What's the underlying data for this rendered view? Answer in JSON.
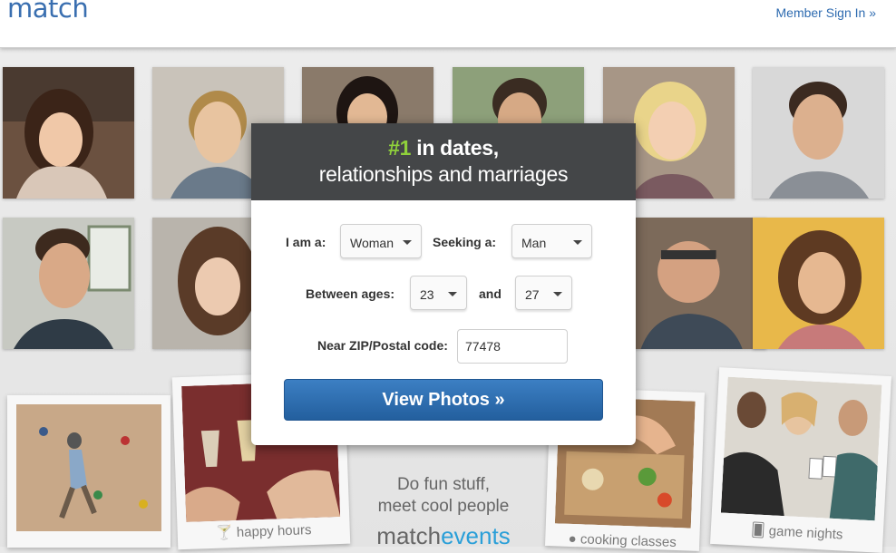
{
  "header": {
    "logo": "match",
    "signin": "Member Sign In »"
  },
  "modal": {
    "tag_num": "#1",
    "tag_rest": " in dates,",
    "tag_line2": "relationships and marriages",
    "i_am_label": "I am a:",
    "i_am_value": "Woman",
    "seeking_label": "Seeking a:",
    "seeking_value": "Man",
    "ages_label": "Between ages:",
    "age_min": "23",
    "and_label": "and",
    "age_max": "27",
    "zip_label": "Near ZIP/Postal code:",
    "zip_value": "77478",
    "button": "View Photos »"
  },
  "events": {
    "line1": "Do fun stuff,",
    "line2": "meet cool people",
    "brand_a": "match",
    "brand_b": "events",
    "cap_happy": "happy hours",
    "cap_cooking": "cooking classes",
    "cap_game": "game nights"
  },
  "colors": {
    "brand_blue": "#3a6fb0",
    "accent_green": "#8fd03b",
    "button_blue": "#2f6fb0",
    "events_blue": "#2a9fd8"
  }
}
